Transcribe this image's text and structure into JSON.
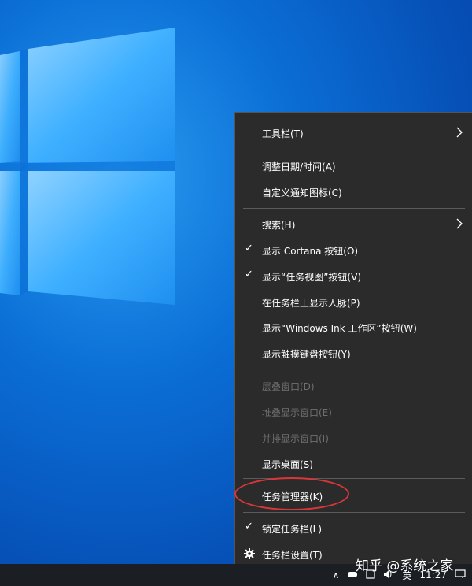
{
  "desktop": {
    "wallpaper": "Windows 10 default blue",
    "watermark": "知乎 @系统之家"
  },
  "context_menu": {
    "items": [
      {
        "label": "工具栏(T)",
        "enabled": true,
        "checked": false,
        "submenu": true
      },
      {
        "label": "调整日期/时间(A)",
        "enabled": true,
        "checked": false
      },
      {
        "label": "自定义通知图标(C)",
        "enabled": true,
        "checked": false
      },
      {
        "label": "搜索(H)",
        "enabled": true,
        "checked": false,
        "submenu": true
      },
      {
        "label": "显示 Cortana 按钮(O)",
        "enabled": true,
        "checked": true
      },
      {
        "label": "显示“任务视图”按钮(V)",
        "enabled": true,
        "checked": true
      },
      {
        "label": "在任务栏上显示人脉(P)",
        "enabled": true,
        "checked": false
      },
      {
        "label": "显示“Windows Ink 工作区”按钮(W)",
        "enabled": true,
        "checked": false
      },
      {
        "label": "显示触摸键盘按钮(Y)",
        "enabled": true,
        "checked": false
      },
      {
        "label": "层叠窗口(D)",
        "enabled": false,
        "checked": false
      },
      {
        "label": "堆叠显示窗口(E)",
        "enabled": false,
        "checked": false
      },
      {
        "label": "并排显示窗口(I)",
        "enabled": false,
        "checked": false
      },
      {
        "label": "显示桌面(S)",
        "enabled": true,
        "checked": false
      },
      {
        "label": "任务管理器(K)",
        "enabled": true,
        "checked": false,
        "highlighted": true
      },
      {
        "label": "锁定任务栏(L)",
        "enabled": true,
        "checked": true
      },
      {
        "label": "任务栏设置(T)",
        "enabled": true,
        "checked": false,
        "icon": "gear-icon"
      }
    ],
    "check_glyph": "✓",
    "highlight_color": "#d8363b"
  },
  "taskbar": {
    "tray": {
      "chevron": "∧",
      "ime": "英",
      "time": "11:27"
    }
  }
}
